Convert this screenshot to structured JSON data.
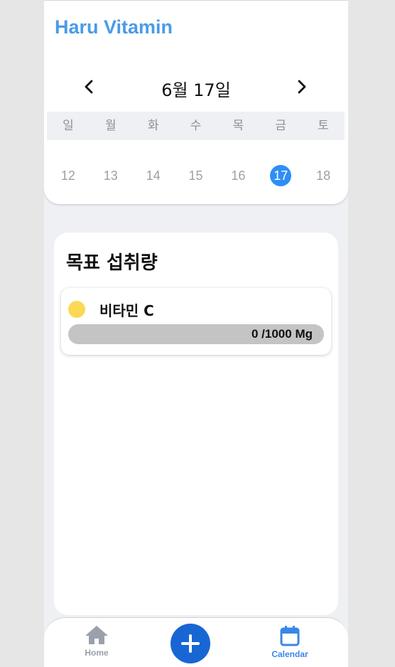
{
  "app": {
    "title": "Haru Vitamin"
  },
  "calendar": {
    "date_label": "6월 17일",
    "weekdays": [
      "일",
      "월",
      "화",
      "수",
      "목",
      "금",
      "토"
    ],
    "dates": [
      "12",
      "13",
      "14",
      "15",
      "16",
      "17",
      "18"
    ],
    "selected_date": "17"
  },
  "goal": {
    "title": "목표 섭취량",
    "items": [
      {
        "name": "비타민 C",
        "progress_text": "0 /1000 Mg",
        "progress_fraction": 0,
        "color": "#fcd856"
      }
    ]
  },
  "bottom_nav": {
    "home_label": "Home",
    "calendar_label": "Calendar",
    "active": "Calendar"
  },
  "icons": {
    "prev": "chevron-left-icon",
    "next": "chevron-right-icon",
    "home": "home-icon",
    "add": "plus-icon",
    "calendar": "calendar-icon"
  },
  "colors": {
    "accent": "#4a9be8",
    "selected_date": "#2f8ef5",
    "add_button": "#1866d4",
    "progress_track": "#c4c4c4"
  }
}
